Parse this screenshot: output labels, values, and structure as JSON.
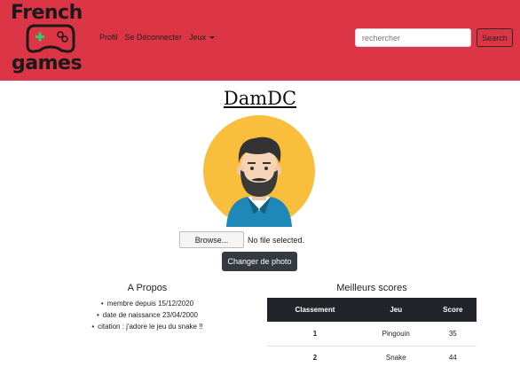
{
  "navbar": {
    "logo_line1": "French",
    "logo_line2": "games",
    "links": [
      "Profil",
      "Se Déconnecter",
      "Jeux"
    ],
    "search_placeholder": "rechercher",
    "search_button": "Search",
    "background_color": "#dc3545"
  },
  "profile": {
    "username": "DamDC",
    "avatar_icon": "bearded-man-avatar-icon",
    "file_button": "Browse...",
    "file_status": "No file selected.",
    "change_button": "Changer de photo"
  },
  "about": {
    "title": "A Propos",
    "items": [
      "membre depuis 15/12/2020",
      "date de naissance 23/04/2000",
      "citation : j'adore le jeu du snake !!"
    ]
  },
  "scores": {
    "title": "Meilleurs scores",
    "headers": [
      "Classement",
      "Jeu",
      "Score"
    ],
    "rows": [
      {
        "rank": "1",
        "game": "Pingouin",
        "score": "35"
      },
      {
        "rank": "2",
        "game": "Snake",
        "score": "44"
      }
    ]
  }
}
